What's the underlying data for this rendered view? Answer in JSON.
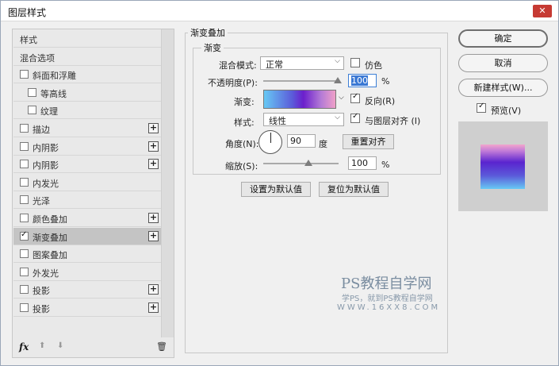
{
  "window": {
    "title": "图层样式",
    "close": "✕"
  },
  "left_panel": {
    "items": [
      {
        "label": "样式",
        "checkbox": false,
        "checked": false,
        "plus": false,
        "indent": 0
      },
      {
        "label": "混合选项",
        "checkbox": false,
        "checked": false,
        "plus": false,
        "indent": 0
      },
      {
        "label": "斜面和浮雕",
        "checkbox": true,
        "checked": false,
        "plus": false,
        "indent": 0
      },
      {
        "label": "等高线",
        "checkbox": true,
        "checked": false,
        "plus": false,
        "indent": 1
      },
      {
        "label": "纹理",
        "checkbox": true,
        "checked": false,
        "plus": false,
        "indent": 1
      },
      {
        "label": "描边",
        "checkbox": true,
        "checked": false,
        "plus": true,
        "indent": 0
      },
      {
        "label": "内阴影",
        "checkbox": true,
        "checked": false,
        "plus": true,
        "indent": 0
      },
      {
        "label": "内阴影",
        "checkbox": true,
        "checked": false,
        "plus": true,
        "indent": 0
      },
      {
        "label": "内发光",
        "checkbox": true,
        "checked": false,
        "plus": false,
        "indent": 0
      },
      {
        "label": "光泽",
        "checkbox": true,
        "checked": false,
        "plus": false,
        "indent": 0
      },
      {
        "label": "颜色叠加",
        "checkbox": true,
        "checked": false,
        "plus": true,
        "indent": 0
      },
      {
        "label": "渐变叠加",
        "checkbox": true,
        "checked": true,
        "plus": true,
        "indent": 0,
        "selected": true
      },
      {
        "label": "图案叠加",
        "checkbox": true,
        "checked": false,
        "plus": false,
        "indent": 0
      },
      {
        "label": "外发光",
        "checkbox": true,
        "checked": false,
        "plus": false,
        "indent": 0
      },
      {
        "label": "投影",
        "checkbox": true,
        "checked": false,
        "plus": true,
        "indent": 0
      },
      {
        "label": "投影",
        "checkbox": true,
        "checked": false,
        "plus": true,
        "indent": 0
      }
    ],
    "footer": {
      "fx": "fx",
      "up": "⬆",
      "down": "⬇",
      "trash": "🗑"
    }
  },
  "gradient_overlay": {
    "group_title": "渐变叠加",
    "sub_title": "渐变",
    "blend_mode_label": "混合模式:",
    "blend_mode_value": "正常",
    "dither_label": "仿色",
    "opacity_label": "不透明度(P):",
    "opacity_value": "100",
    "opacity_unit": "%",
    "gradient_label": "渐变:",
    "reverse_label": "反向(R)",
    "style_label": "样式:",
    "style_value": "线性",
    "align_label": "与图层对齐 (I)",
    "angle_label": "角度(N):",
    "angle_value": "90",
    "angle_unit": "度",
    "reset_align_button": "重置对齐",
    "scale_label": "缩放(S):",
    "scale_value": "100",
    "scale_unit": "%",
    "set_default_button": "设置为默认值",
    "reset_default_button": "复位为默认值"
  },
  "right_panel": {
    "ok_button": "确定",
    "cancel_button": "取消",
    "new_style_button": "新建样式(W)...",
    "preview_label": "预览(V)"
  },
  "watermark": {
    "line1": "PS教程自学网",
    "line2": "学PS，就到PS教程自学网",
    "line3": "WWW.16XX8.COM"
  }
}
